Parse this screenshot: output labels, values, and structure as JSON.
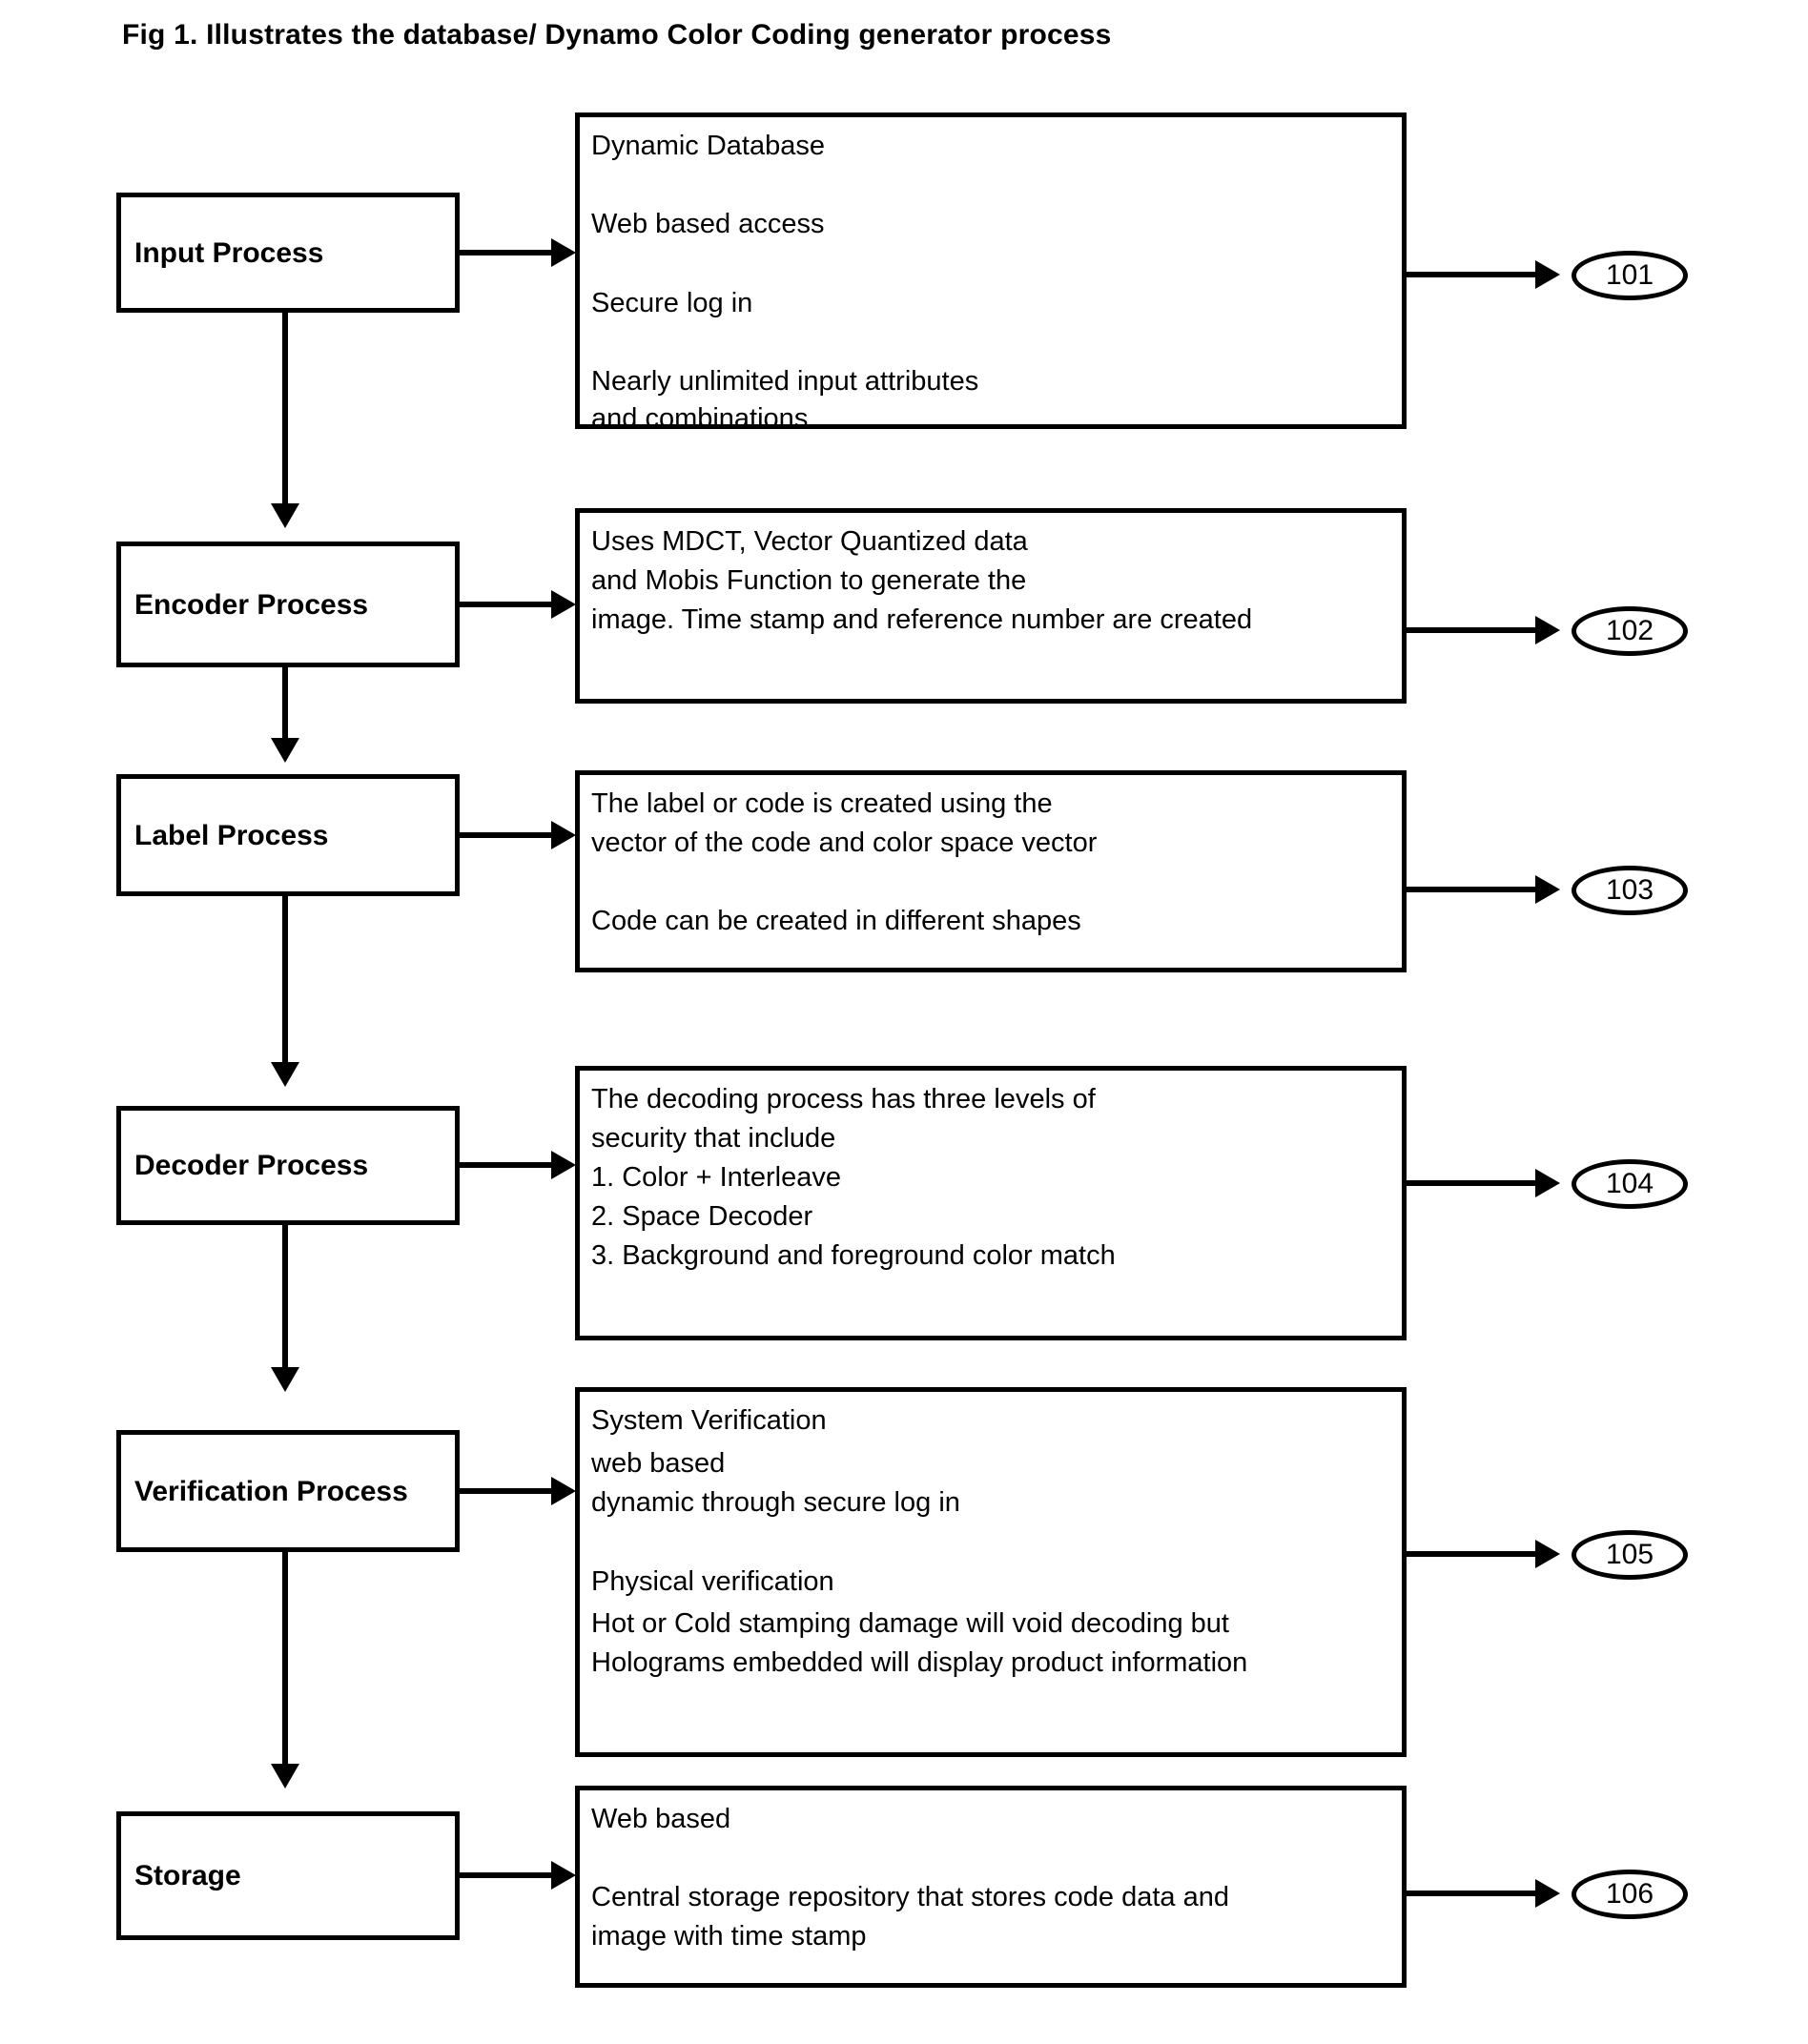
{
  "figure": {
    "title": "Fig 1. Illustrates the database/ Dynamo Color Coding generator process"
  },
  "diagram": {
    "type": "flowchart",
    "orientation": "vertical",
    "steps": [
      {
        "id": "input",
        "process_label": "Input Process",
        "ref_number": "101",
        "description_lines": [
          "Dynamic Database",
          "",
          "Web based access",
          "",
          "Secure log in",
          "",
          "Nearly unlimited input attributes",
          "and combinations"
        ]
      },
      {
        "id": "encoder",
        "process_label": "Encoder Process",
        "ref_number": "102",
        "description_lines": [
          "Uses MDCT, Vector Quantized data",
          "and Mobis Function to generate the",
          "image. Time stamp and reference number are created"
        ]
      },
      {
        "id": "label",
        "process_label": "Label Process",
        "ref_number": "103",
        "description_lines": [
          "The label or code is created using the",
          "vector of the code and color space vector",
          "",
          "Code can be created in different shapes"
        ]
      },
      {
        "id": "decoder",
        "process_label": "Decoder Process",
        "ref_number": "104",
        "description_lines": [
          "The decoding process has three levels of",
          "security that include",
          "1. Color + Interleave",
          "2. Space Decoder",
          "3. Background and foreground color match"
        ]
      },
      {
        "id": "verification",
        "process_label": "Verification Process",
        "ref_number": "105",
        "description_heading_1": "System Verification ",
        "description_lines_1": [
          "web based",
          "dynamic through secure log in"
        ],
        "description_heading_2": "Physical verification",
        "description_lines_2": [
          "Hot or Cold stamping damage will void decoding but",
          "Holograms embedded will display product information"
        ]
      },
      {
        "id": "storage",
        "process_label": "Storage",
        "ref_number": "106",
        "description_lines": [
          "Web based",
          "",
          "Central storage repository that stores code data and",
          "image with time stamp"
        ]
      }
    ],
    "colors": {
      "stroke": "#000000",
      "fill": "#ffffff",
      "text": "#000000"
    }
  }
}
